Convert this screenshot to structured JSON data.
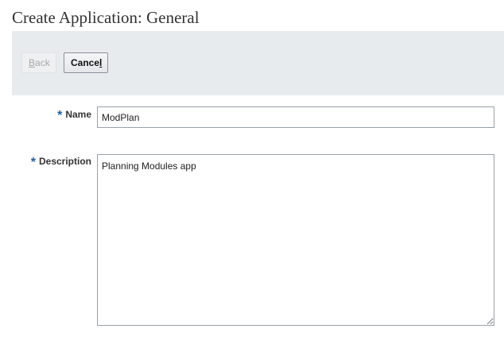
{
  "page": {
    "title": "Create Application: General"
  },
  "toolbar": {
    "back_prefix": "",
    "back_mnemonic": "B",
    "back_suffix": "ack",
    "cancel_prefix": "Cance",
    "cancel_mnemonic": "l",
    "cancel_suffix": ""
  },
  "form": {
    "required_marker": "*",
    "name_label": "Name",
    "name_value": "ModPlan",
    "description_label": "Description",
    "description_value": "Planning Modules app"
  },
  "colors": {
    "toolbar_background": "#e8ebee",
    "required_marker": "#1f5fa8"
  }
}
